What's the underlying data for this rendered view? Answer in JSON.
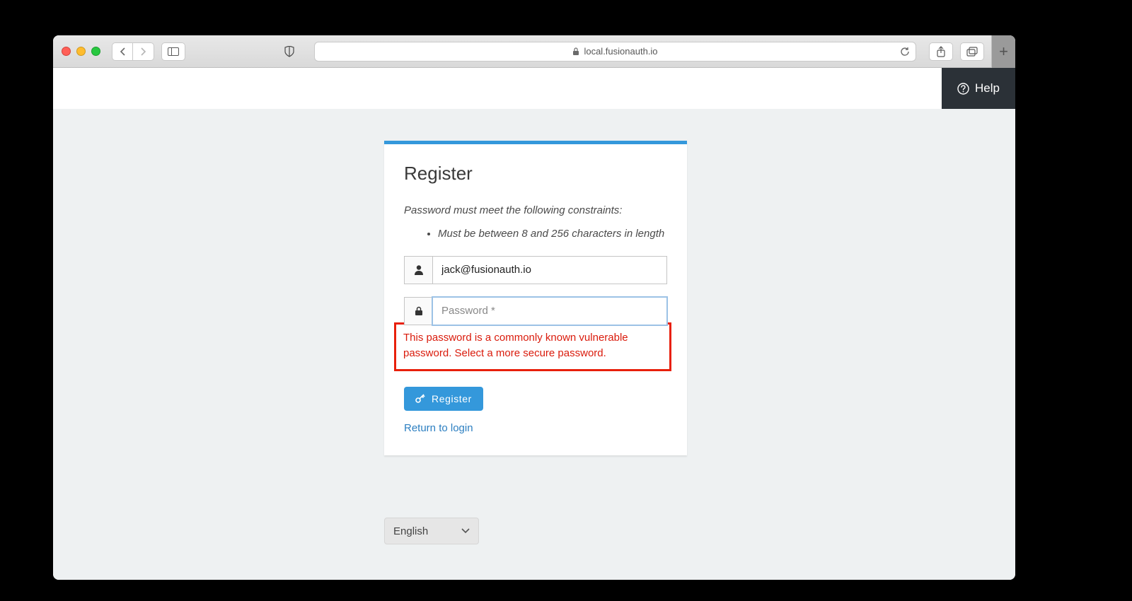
{
  "browser": {
    "url_host": "local.fusionauth.io"
  },
  "header": {
    "help_label": "Help"
  },
  "card": {
    "title": "Register",
    "constraints_lead": "Password must meet the following constraints:",
    "constraints": [
      "Must be between 8 and 256 characters in length"
    ],
    "email_value": "jack@fusionauth.io",
    "password_placeholder": "Password *",
    "password_value": "",
    "error_message": "This password is a commonly known vulnerable password. Select a more secure password.",
    "submit_label": "Register",
    "return_link_label": "Return to login"
  },
  "language_selector": {
    "selected": "English"
  }
}
